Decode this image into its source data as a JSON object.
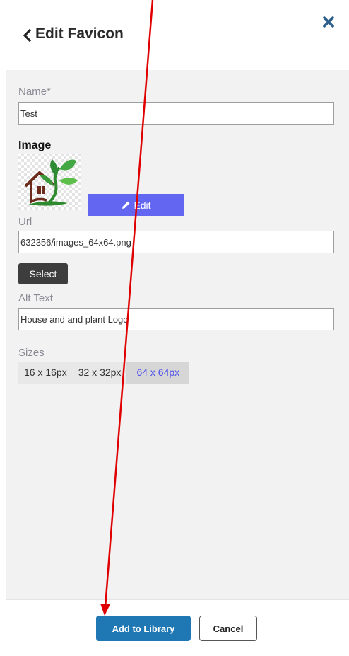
{
  "header": {
    "title": "Edit Favicon",
    "back_icon": "chevron-left-icon",
    "close_icon": "close-x-icon"
  },
  "form": {
    "name_label": "Name*",
    "name_value": "Test",
    "image_heading": "Image",
    "edit_button_label": "Edit",
    "url_label": "Url",
    "url_value": "632356/images_64x64.png",
    "select_button_label": "Select",
    "alt_label": "Alt Text",
    "alt_value": "House and and plant Logo",
    "sizes_label": "Sizes",
    "sizes": [
      {
        "label": "16 x 16px",
        "active": false
      },
      {
        "label": "32 x 32px",
        "active": false
      },
      {
        "label": "64 x 64px",
        "active": true
      }
    ]
  },
  "footer": {
    "add_button_label": "Add to Library",
    "cancel_button_label": "Cancel"
  },
  "colors": {
    "accent": "#6366f1",
    "primary_button": "#1f78b4",
    "close_icon": "#2e5f8a",
    "annotation_arrow": "#e00000"
  }
}
